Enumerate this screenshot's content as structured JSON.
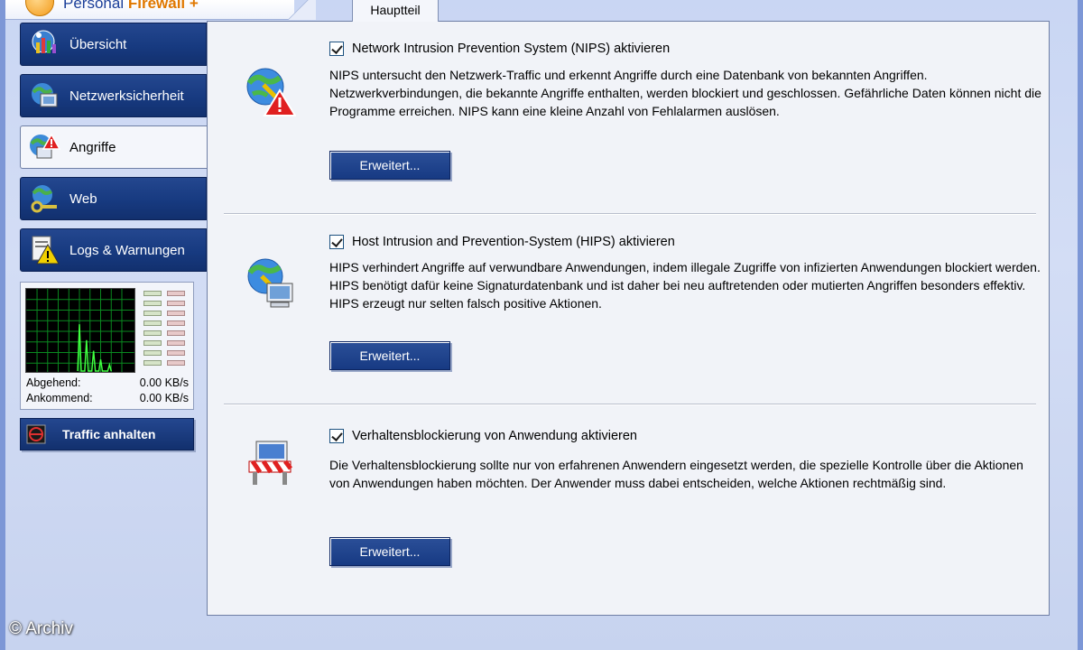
{
  "app": {
    "logo_text_prefix": "Personal",
    "logo_text_brand": "Firewall",
    "logo_text_suffix": "+"
  },
  "tabs": [
    {
      "label": "Hauptteil",
      "active": true
    }
  ],
  "sidebar": {
    "items": [
      {
        "label": "Übersicht",
        "icon": "overview-icon",
        "active": false
      },
      {
        "label": "Netzwerksicherheit",
        "icon": "network-security-icon",
        "active": false
      },
      {
        "label": "Angriffe",
        "icon": "attacks-icon",
        "active": true
      },
      {
        "label": "Web",
        "icon": "web-icon",
        "active": false
      },
      {
        "label": "Logs & Warnungen",
        "icon": "logs-warning-icon",
        "active": false
      }
    ],
    "traffic": {
      "outgoing_label": "Abgehend:",
      "outgoing_value": "0.00 KB/s",
      "incoming_label": "Ankommend:",
      "incoming_value": "0.00 KB/s"
    },
    "stop_button_label": "Traffic anhalten"
  },
  "sections": [
    {
      "icon": "globe-warning-icon",
      "checkbox_label": "Network Intrusion Prevention System (NIPS) aktivieren",
      "checked": true,
      "description": "NIPS untersucht den Netzwerk-Traffic und erkennt Angriffe durch eine Datenbank von bekannten Angriffen. Netzwerkverbindungen, die bekannte Angriffe enthalten, werden blockiert und geschlossen. Gefährliche Daten können nicht die Programme erreichen. NIPS kann eine kleine Anzahl von Fehlalarmen auslösen.",
      "button_label": "Erweitert..."
    },
    {
      "icon": "globe-computer-icon",
      "checkbox_label": "Host Intrusion and Prevention-System (HIPS) aktivieren",
      "checked": true,
      "description": "HIPS verhindert Angriffe auf verwundbare Anwendungen, indem illegale Zugriffe von infizierten Anwendungen blockiert werden. HIPS benötigt dafür keine Signaturdatenbank und ist daher bei neu auftretenden oder mutierten Angriffen besonders effektiv. HIPS erzeugt nur selten falsch positive Aktionen.",
      "button_label": "Erweitert..."
    },
    {
      "icon": "roadblock-icon",
      "checkbox_label": "Verhaltensblockierung von Anwendung aktivieren",
      "checked": true,
      "description": "Die Verhaltensblockierung sollte nur von erfahrenen Anwendern eingesetzt werden, die spezielle Kontrolle über die Aktionen von Anwendungen haben möchten. Der Anwender muss dabei entscheiden, welche Aktionen rechtmäßig sind.",
      "button_label": "Erweitert..."
    }
  ],
  "watermark": "© Archiv",
  "colors": {
    "nav_blue": "#173a80",
    "panel_bg": "#f1f3f8",
    "frame_bg": "#c9d6f3"
  }
}
